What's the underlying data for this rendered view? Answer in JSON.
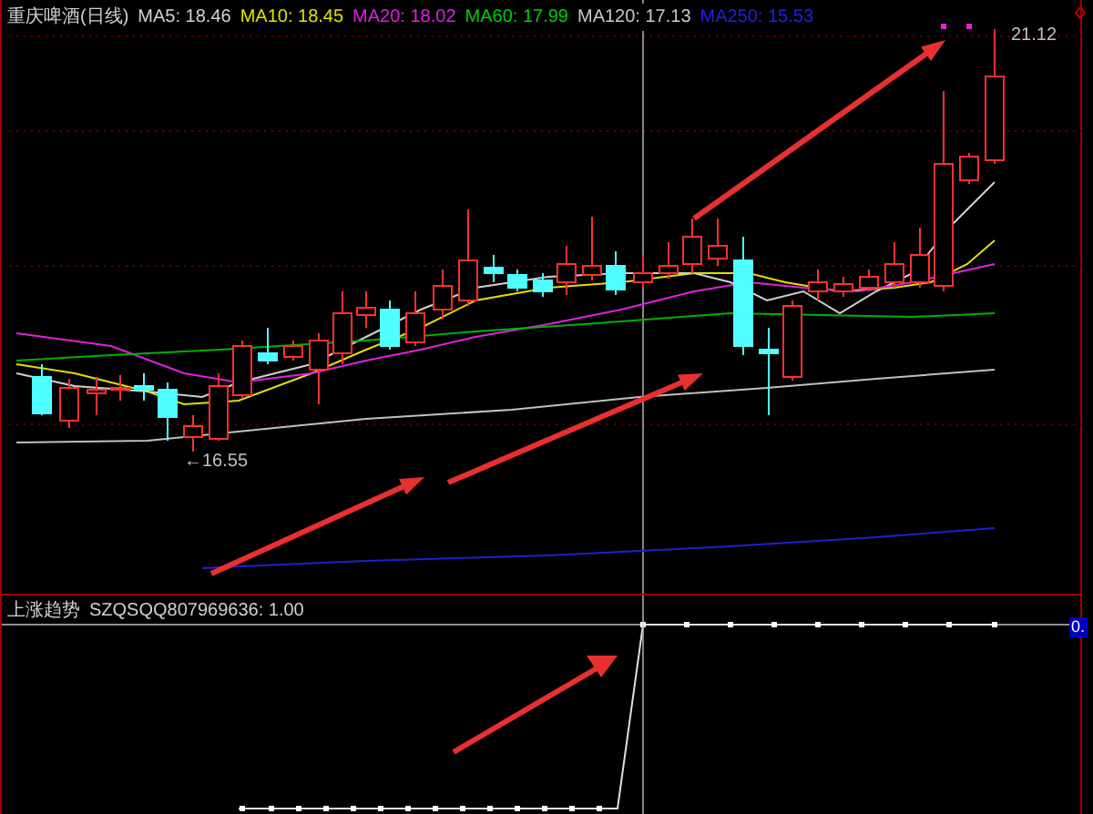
{
  "main_chart": {
    "title": "重庆啤酒(日线)",
    "ma_labels": [
      {
        "label": "MA5: 18.46",
        "color": "#d0d0d0"
      },
      {
        "label": "MA10: 18.45",
        "color": "#e0e000"
      },
      {
        "label": "MA20: 18.02",
        "color": "#e020e0"
      },
      {
        "label": "MA60: 17.99",
        "color": "#00d000"
      },
      {
        "label": "MA120: 17.13",
        "color": "#c8c8c8"
      },
      {
        "label": "MA250: 15.53",
        "color": "#2020e0"
      }
    ],
    "low_label": "←16.55",
    "high_label": "21.12"
  },
  "indicator": {
    "title": "上涨趋势",
    "formula": "SZQSQQ807969636: 1.00",
    "axis_value": "0."
  }
}
